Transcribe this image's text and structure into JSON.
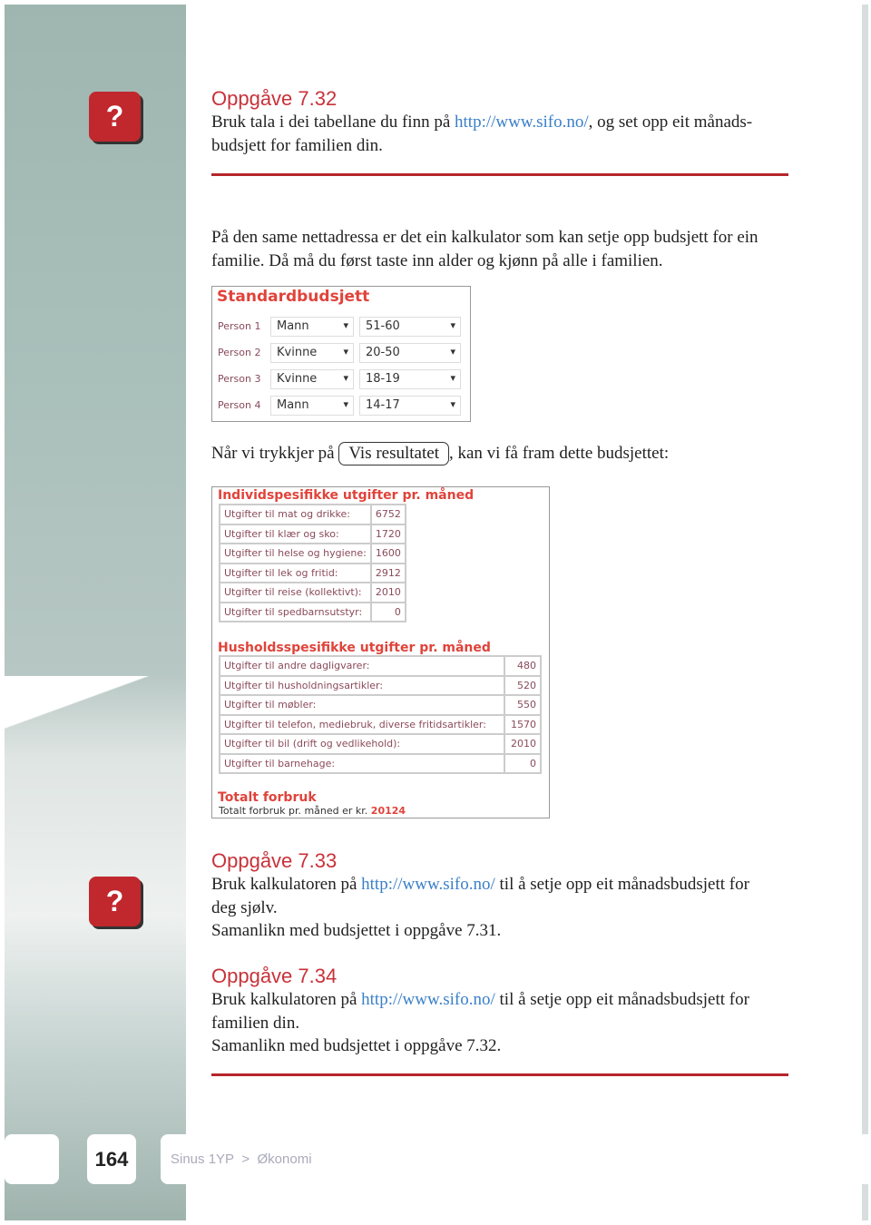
{
  "tasks": [
    {
      "title": "Oppgåve 7.32",
      "text_before": "Bruk tala i dei tabellane du finn på ",
      "link": "http://www.sifo.no/",
      "text_after": ", og set opp eit månads-budsjett for familien din."
    },
    {
      "title": "Oppgåve 7.33",
      "text_before": "Bruk kalkulatoren på ",
      "link": "http://www.sifo.no/",
      "text_after": " til å setje opp eit månadsbudsjett for deg sjølv.",
      "line2": "Samanlikn med budsjettet i oppgåve 7.31."
    },
    {
      "title": "Oppgåve 7.34",
      "text_before": "Bruk kalkulatoren på ",
      "link": "http://www.sifo.no/",
      "text_after": " til å setje opp eit månadsbudsjett for familien din.",
      "line2": "Samanlikn med budsjettet i oppgåve 7.32."
    }
  ],
  "question_icon": "?",
  "intro": "På den same nettadressa er det ein kalkulator som kan setje opp budsjett for ein familie. Då må du først taste inn alder og kjønn på alle i familien.",
  "standard": {
    "title": "Standardbudsjett",
    "persons": [
      {
        "label": "Person 1",
        "gender": "Mann",
        "age": "51-60"
      },
      {
        "label": "Person 2",
        "gender": "Kvinne",
        "age": "20-50"
      },
      {
        "label": "Person 3",
        "gender": "Kvinne",
        "age": "18-19"
      },
      {
        "label": "Person 4",
        "gender": "Mann",
        "age": "14-17"
      }
    ]
  },
  "result_line": {
    "before": "Når vi trykkjer på",
    "button": "Vis resultatet",
    "after": ",  kan vi få fram dette budsjettet:"
  },
  "individual": {
    "title": "Individspesifikke utgifter pr. måned",
    "rows": [
      [
        "Utgifter til mat og drikke:",
        "6752"
      ],
      [
        "Utgifter til klær og sko:",
        "1720"
      ],
      [
        "Utgifter til helse og hygiene:",
        "1600"
      ],
      [
        "Utgifter til lek og fritid:",
        "2912"
      ],
      [
        "Utgifter til reise (kollektivt):",
        "2010"
      ],
      [
        "Utgifter til spedbarnsutstyr:",
        "0"
      ]
    ]
  },
  "household": {
    "title": "Husholdsspesifikke utgifter pr. måned",
    "rows": [
      [
        "Utgifter til andre dagligvarer:",
        "480"
      ],
      [
        "Utgifter til husholdningsartikler:",
        "520"
      ],
      [
        "Utgifter til møbler:",
        "550"
      ],
      [
        "Utgifter til telefon, mediebruk, diverse fritidsartikler:",
        "1570"
      ],
      [
        "Utgifter til bil (drift og vedlikehold):",
        "2010"
      ],
      [
        "Utgifter til barnehage:",
        "0"
      ]
    ]
  },
  "total": {
    "title": "Totalt forbruk",
    "text": "Totalt forbruk pr. måned er kr. ",
    "value": "20124"
  },
  "footer": {
    "page": "164",
    "book": "Sinus 1YP",
    "sep": ">",
    "chapter": "Økonomi"
  },
  "colors": {
    "accent": "#c8323a",
    "link": "#3a7fc8"
  }
}
